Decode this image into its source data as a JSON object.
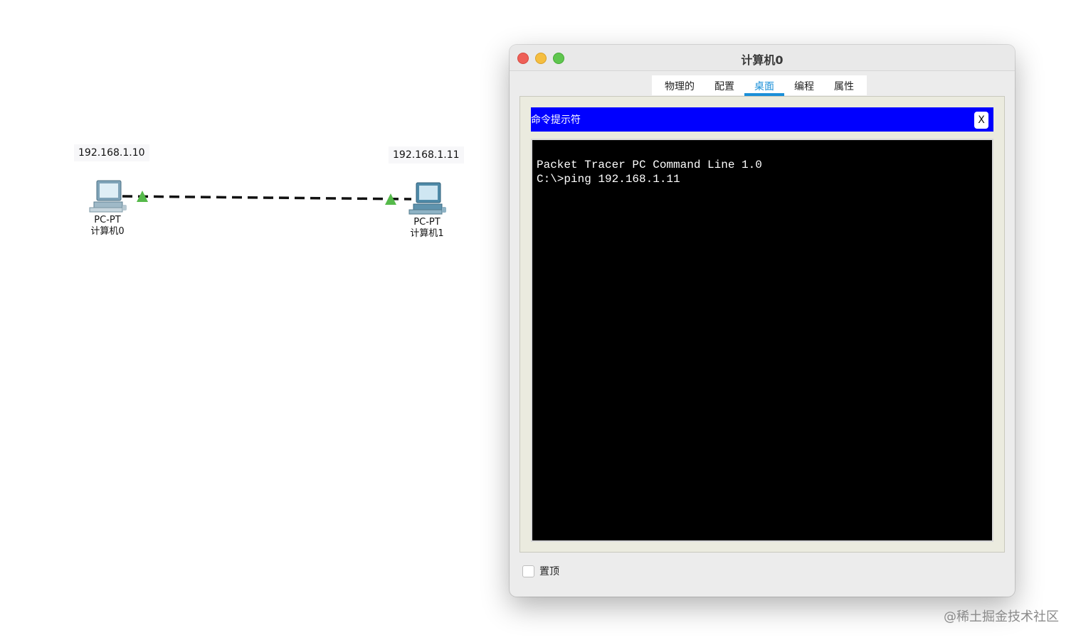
{
  "topology": {
    "devices": [
      {
        "ip": "192.168.1.10",
        "type": "PC-PT",
        "name": "计算机0"
      },
      {
        "ip": "192.168.1.11",
        "type": "PC-PT",
        "name": "计算机1"
      }
    ],
    "link_color": "#111111",
    "link_status_color": "#55b94a"
  },
  "window": {
    "title": "计算机0",
    "tabs": [
      {
        "label": "物理的"
      },
      {
        "label": "配置"
      },
      {
        "label": "桌面",
        "active": true
      },
      {
        "label": "编程"
      },
      {
        "label": "属性"
      }
    ],
    "cmd": {
      "title": "命令提示符",
      "close_label": "X",
      "header_color": "#0000ff",
      "lines": [
        "Packet Tracer PC Command Line 1.0",
        "C:\\>ping 192.168.1.11"
      ]
    },
    "pin_on_top": {
      "label": "置顶",
      "checked": false
    }
  },
  "watermark": "@稀土掘金技术社区"
}
